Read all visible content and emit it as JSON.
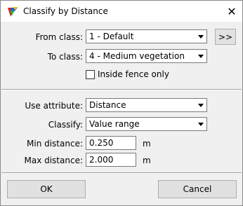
{
  "window": {
    "title": "Classify by Distance",
    "close_glyph": "✕"
  },
  "section1": {
    "from_class_label": "From class:",
    "from_class_value": "1 - Default",
    "more_button_label": ">>",
    "to_class_label": "To class:",
    "to_class_value": "4 - Medium vegetation",
    "inside_fence_label": "Inside fence only"
  },
  "section2": {
    "use_attribute_label": "Use attribute:",
    "use_attribute_value": "Distance",
    "classify_label": "Classify:",
    "classify_value": "Value range",
    "min_distance_label": "Min distance:",
    "min_distance_value": "0.250",
    "min_distance_unit": "m",
    "max_distance_label": "Max distance:",
    "max_distance_value": "2.000",
    "max_distance_unit": "m"
  },
  "footer": {
    "ok_label": "OK",
    "cancel_label": "Cancel"
  },
  "colors": {
    "dialog_bg": "#f0f0f0",
    "titlebar_bg": "#ffffff",
    "field_border": "#7a7a7a",
    "button_bg": "#e1e1e1"
  }
}
